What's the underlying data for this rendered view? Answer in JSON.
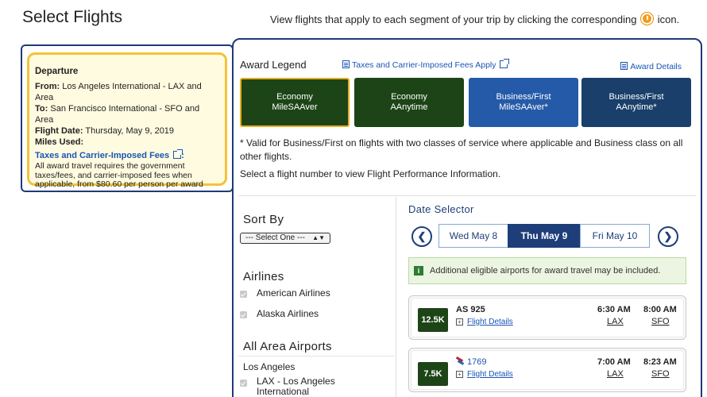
{
  "header": {
    "title": "Select Flights",
    "subtitle_before": "View flights that apply to each segment of your trip by clicking the corresponding",
    "subtitle_after": "icon."
  },
  "departure": {
    "title": "Departure",
    "from_label": "From:",
    "from_value": "Los Angeles International - LAX and Area",
    "to_label": "To:",
    "to_value": "San Francisco International - SFO and Area",
    "date_label": "Flight Date:",
    "date_value": "Thursday, May 9, 2019",
    "miles_label": "Miles Used:",
    "taxes_link": "Taxes and Carrier-Imposed Fees",
    "taxes_link_suffix": ":",
    "taxes_note": "All award travel requires the government taxes/fees, and carrier-imposed fees when applicable, from $80.60 per person per award"
  },
  "legend": {
    "title": "Award Legend",
    "taxes_link": "Taxes and Carrier-Imposed Fees Apply",
    "details_link": "Award Details",
    "buttons": [
      {
        "line1": "Economy",
        "line2": "MileSAAver"
      },
      {
        "line1": "Economy",
        "line2": "AAnytime"
      },
      {
        "line1": "Business/First",
        "line2": "MileSAAver*"
      },
      {
        "line1": "Business/First",
        "line2": "AAnytime*"
      }
    ],
    "valid_note": "* Valid for Business/First on flights with two classes of service where applicable and Business class on all other flights.",
    "select_note": "Select a flight number to view Flight Performance Information."
  },
  "filters": {
    "sort_heading": "Sort By",
    "sort_value": "--- Select One ---",
    "airlines_heading": "Airlines",
    "airlines": [
      "American Airlines",
      "Alaska Airlines"
    ],
    "area_heading": "All Area Airports",
    "area_city": "Los Angeles",
    "area_airport": "LAX - Los Angeles International"
  },
  "dates": {
    "heading": "Date Selector",
    "prev_icon": "chevron-left-icon",
    "next_icon": "chevron-right-icon",
    "tabs": [
      "Wed May 8",
      "Thu May 9",
      "Fri May 10"
    ],
    "selected_index": 1
  },
  "info": {
    "text": "Additional eligible airports for award travel may be included."
  },
  "flights": [
    {
      "miles": "12.5K",
      "flight": "AS 925",
      "details": "Flight Details",
      "depart": "6:30 AM",
      "arrive": "8:00 AM",
      "from": "LAX",
      "to": "SFO"
    },
    {
      "miles": "7.5K",
      "flight": "1769",
      "details": "Flight Details",
      "depart": "7:00 AM",
      "arrive": "8:23 AM",
      "from": "LAX",
      "to": "SFO"
    }
  ],
  "colors": {
    "navy": "#1f3a7a",
    "economy_green": "#1d4417",
    "business_blue": "#255aa8",
    "business_navy": "#193f6a",
    "gold": "#f2c437"
  }
}
